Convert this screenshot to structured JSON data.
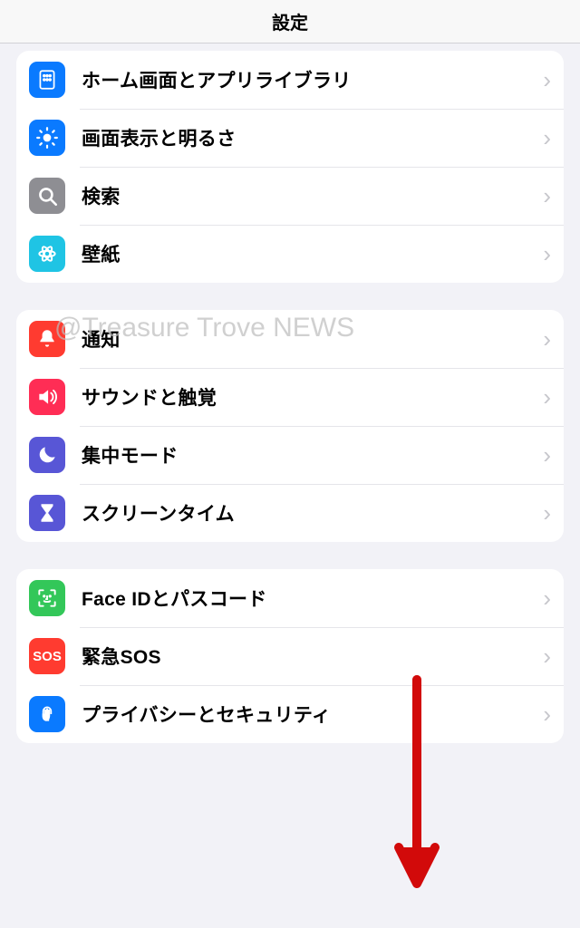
{
  "header": {
    "title": "設定"
  },
  "watermark": "@Treasure Trove NEWS",
  "groups": [
    {
      "rows": [
        {
          "icon": "home-grid-icon",
          "bg": "bg-blue",
          "label": "ホーム画面とアプリライブラリ"
        },
        {
          "icon": "brightness-icon",
          "bg": "bg-blue",
          "label": "画面表示と明るさ"
        },
        {
          "icon": "search-icon",
          "bg": "bg-gray",
          "label": "検索"
        },
        {
          "icon": "wallpaper-icon",
          "bg": "bg-cyan",
          "label": "壁紙"
        }
      ]
    },
    {
      "rows": [
        {
          "icon": "notification-icon",
          "bg": "bg-red",
          "label": "通知"
        },
        {
          "icon": "sound-icon",
          "bg": "bg-pink",
          "label": "サウンドと触覚"
        },
        {
          "icon": "focus-icon",
          "bg": "bg-indigo",
          "label": "集中モード"
        },
        {
          "icon": "screentime-icon",
          "bg": "bg-indigo",
          "label": "スクリーンタイム"
        }
      ]
    },
    {
      "rows": [
        {
          "icon": "faceid-icon",
          "bg": "bg-green",
          "label": "Face IDとパスコード"
        },
        {
          "icon": "sos-icon",
          "bg": "bg-sos",
          "label": "緊急SOS"
        },
        {
          "icon": "privacy-icon",
          "bg": "bg-blue",
          "label": "プライバシーとセキュリティ"
        }
      ]
    }
  ]
}
